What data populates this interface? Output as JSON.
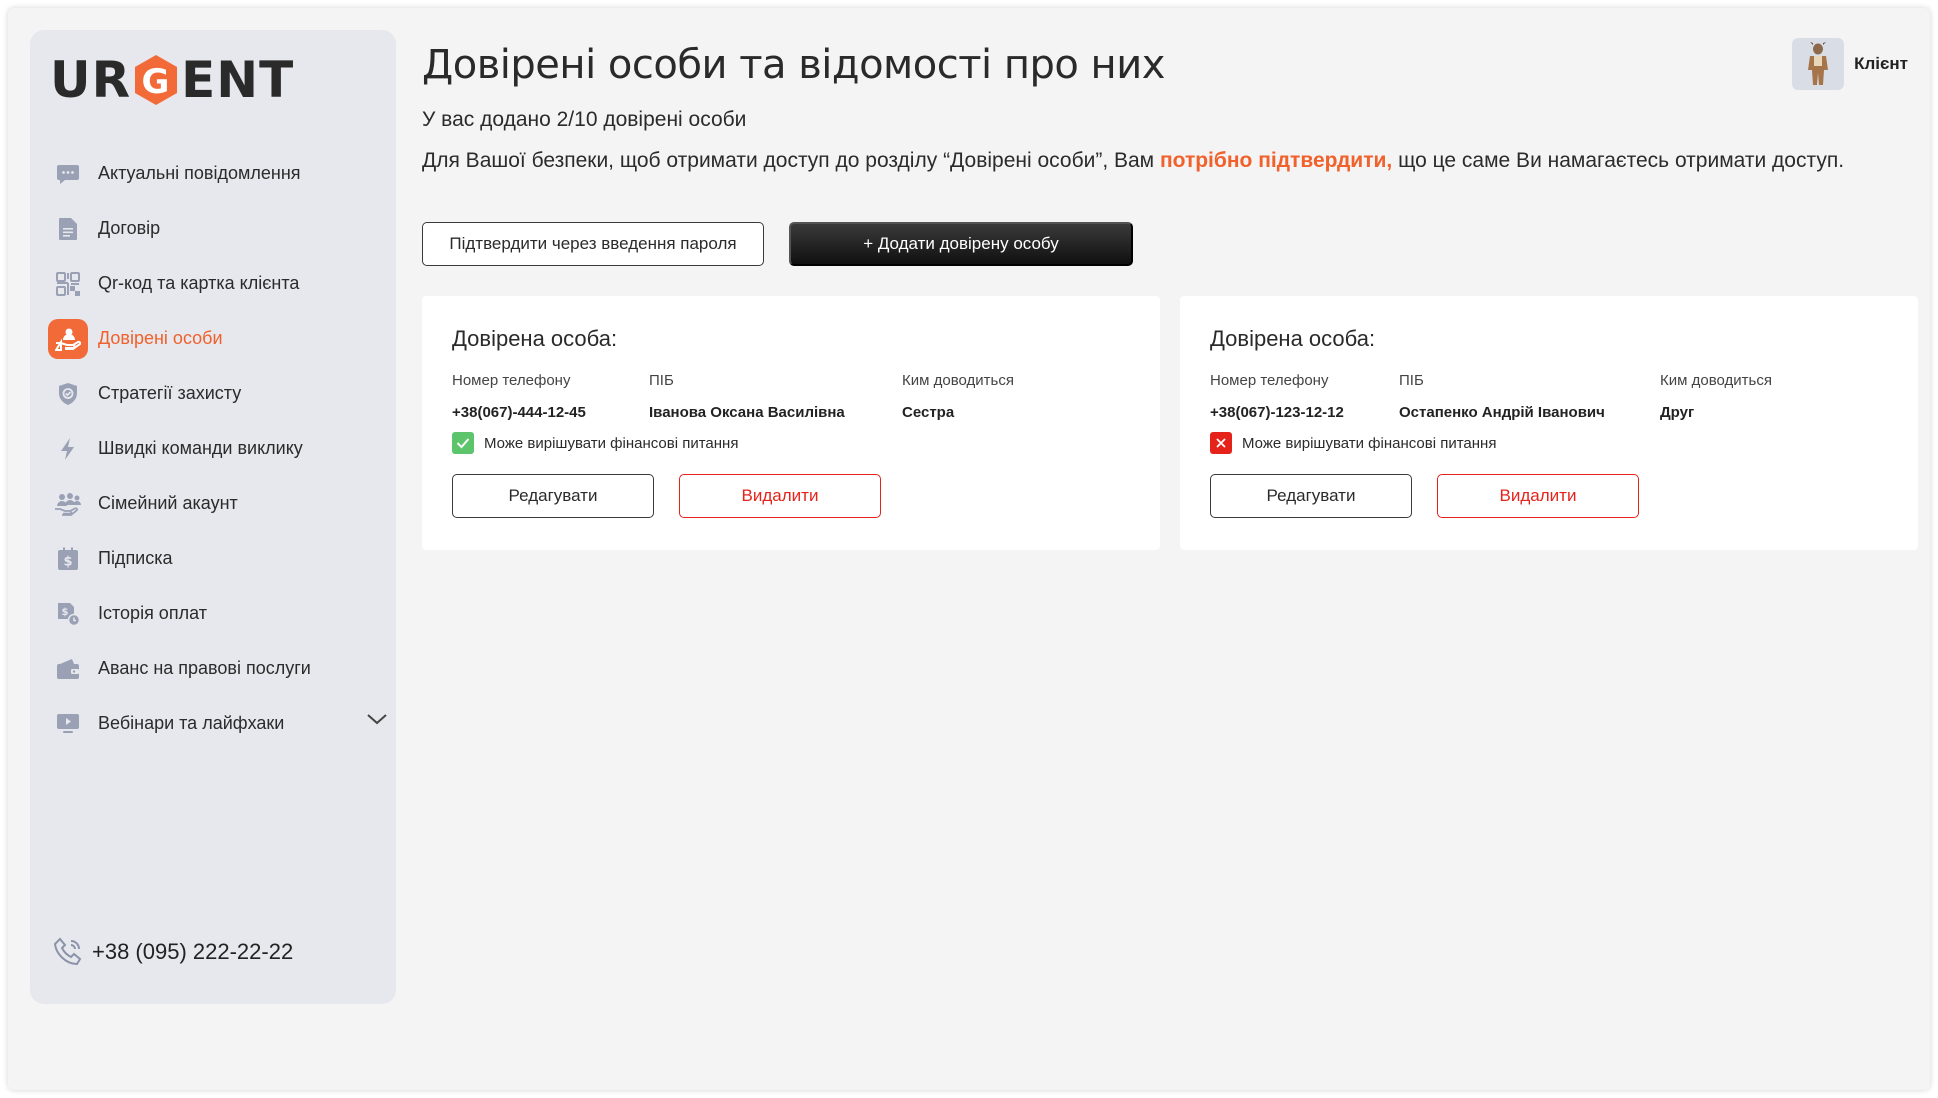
{
  "brand": {
    "logo_left": "UR",
    "logo_mark": "G",
    "logo_right": "ENT",
    "accent": "#f0612c"
  },
  "sidebar": {
    "items": [
      {
        "label": "Актуальні повідомлення",
        "icon": "message-icon"
      },
      {
        "label": "Договір",
        "icon": "document-icon"
      },
      {
        "label": "Qr-код та картка клієнта",
        "icon": "qr-code-icon"
      },
      {
        "label": "Довірені особи",
        "icon": "trusted-person-icon",
        "active": true
      },
      {
        "label": "Стратегії захисту",
        "icon": "shield-icon"
      },
      {
        "label": "Швидкі команди виклику",
        "icon": "lightning-icon"
      },
      {
        "label": "Сімейний акаунт",
        "icon": "family-icon"
      },
      {
        "label": "Підписка",
        "icon": "subscription-icon"
      },
      {
        "label": "Історія оплат",
        "icon": "payment-history-icon"
      },
      {
        "label": "Аванс на правові послуги",
        "icon": "wallet-icon"
      },
      {
        "label": "Вебінари та лайфхаки",
        "icon": "video-icon"
      }
    ],
    "phone": "+38 (095) 222-22-22"
  },
  "header": {
    "title": "Довірені особи та відомості про них",
    "user_label": "Клієнт"
  },
  "main": {
    "count_text": "У вас додано 2/10 довірені особи",
    "notice_before": "Для Вашої безпеки, щоб отримати доступ до розділу “Довірені особи”, Вам ",
    "notice_highlight": "потрібно підтвердити,",
    "notice_after": " що це саме Ви намагаєтесь отримати доступ.",
    "confirm_button": "Підтвердити через введення пароля",
    "add_button": "+ Додати довірену особу"
  },
  "cards": [
    {
      "title": "Довірена особа:",
      "phone_label": "Номер телефону",
      "name_label": "ПІБ",
      "relation_label": "Ким доводиться",
      "phone": "+38(067)-444-12-45",
      "name": "Іванова Оксана Василівна",
      "relation": "Сестра",
      "finance_label": "Може вирішувати фінансові питання",
      "finance_allowed": true,
      "edit_label": "Редагувати",
      "delete_label": "Видалити"
    },
    {
      "title": "Довірена особа:",
      "phone_label": "Номер телефону",
      "name_label": "ПІБ",
      "relation_label": "Ким доводиться",
      "phone": "+38(067)-123-12-12",
      "name": "Остапенко Андрій Іванович",
      "relation": "Друг",
      "finance_label": "Може вирішувати фінансові питання",
      "finance_allowed": false,
      "edit_label": "Редагувати",
      "delete_label": "Видалити"
    }
  ],
  "colors": {
    "check_ok": "#5cc46a",
    "check_no": "#e5231b",
    "delete": "#e5231b"
  }
}
